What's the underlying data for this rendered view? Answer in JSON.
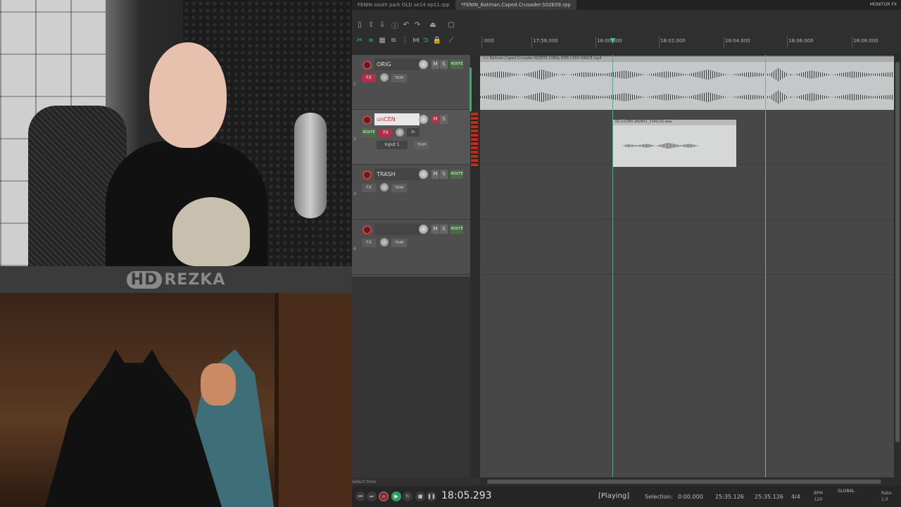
{
  "watermark": {
    "hd": "HD",
    "name": "REZKA"
  },
  "daw": {
    "tabs": [
      "FENIN south park OLD se14 ep11.rpp",
      "*FENIN_Batman.Caped.Crusader.S02E09.rpp"
    ],
    "monitor_fx": "MONITOR FX",
    "ruler": [
      ":000",
      "17:58.000",
      "18:00.000",
      "18:02.000",
      "18:04.000",
      "18:06.000",
      "18:08.000"
    ],
    "tracks": [
      {
        "name": "ORIG",
        "num": "1"
      },
      {
        "name": "unCEN",
        "num": "2",
        "input": "Input 1",
        "in": "in"
      },
      {
        "name": "TRASH",
        "num": "3"
      },
      {
        "name": "",
        "num": "4"
      }
    ],
    "buttons": {
      "m": "M",
      "s": "S",
      "route": "ROUTE",
      "fx": "FX",
      "trim": "TRIM"
    },
    "clips": {
      "orig_title": "<< Batman.Caped.Crusader.S02E09.1080p.WEB.h264-GRACE.mp4",
      "rec_title": "02-unCEN-260801_1545-02.wav"
    },
    "transport": {
      "hint": "Select time",
      "time": "18:05.293",
      "state": "[Playing]",
      "selection_label": "Selection:",
      "sel_start": "0:00.000",
      "sel_end": "25:35.126",
      "sel_len": "25:35.126",
      "meter": "4/4",
      "bpm_label": "BPM",
      "bpm": "120",
      "global": "GLOBAL",
      "rate_label": "Rate:",
      "rate": "1.0"
    }
  }
}
